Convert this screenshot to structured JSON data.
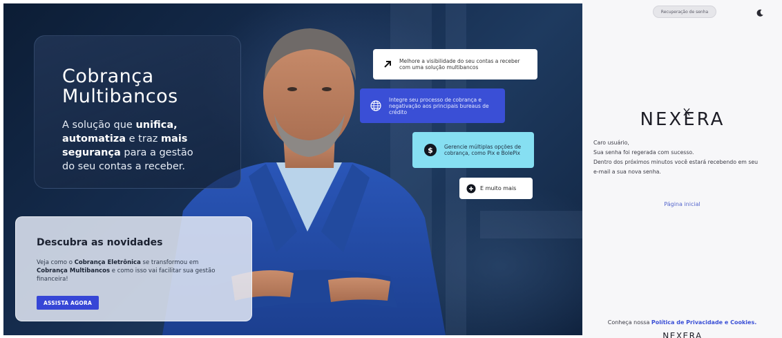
{
  "hero": {
    "title_line1": "Cobrança",
    "title_line2": "Multibancos",
    "subtitle": {
      "p1": "A solução que ",
      "b1": "unifica,",
      "b2": "automatiza",
      "p2": " e traz ",
      "b3": "mais",
      "b4": "segurança",
      "p3": " para a gestão",
      "p4": "do seu contas a receber."
    }
  },
  "features": [
    {
      "icon": "arrow-up-right-icon",
      "text": "Melhore a visibilidade do seu contas a receber com uma solução multibancos"
    },
    {
      "icon": "globe-icon",
      "text": "Integre seu processo de cobrança e negativação aos principais bureaus de crédito"
    },
    {
      "icon": "dollar-icon",
      "text": "Gerencie múltiplas opções de cobrança, como Pix e BolePix"
    },
    {
      "icon": "plus-circle-icon",
      "text": "E muito mais"
    }
  ],
  "news": {
    "title": "Descubra as novidades",
    "t1": "Veja como o ",
    "b1": "Cobrança Eletrônica",
    "t2": " se transformou em ",
    "b2": "Cobrança Multibancos",
    "t3": " e como isso vai facilitar sua gestão financeira!",
    "button": "ASSISTA AGORA"
  },
  "right": {
    "tab_label": "Recuperação de senha",
    "brand": "NEXERA",
    "message": {
      "greeting": "Caro usuário,",
      "line1": "Sua senha foi regerada com sucesso.",
      "line2": "Dentro dos próximos minutos você estará recebendo em seu",
      "line3": "e-mail a sua nova senha."
    },
    "home_link": "Página inicial",
    "footer_text": "Conheça nossa ",
    "footer_link": "Política de Privacidade e Cookies."
  },
  "colors": {
    "accent": "#3a4fd6",
    "cyan_card": "#86dff2",
    "hero_bg": "#162d4f"
  }
}
